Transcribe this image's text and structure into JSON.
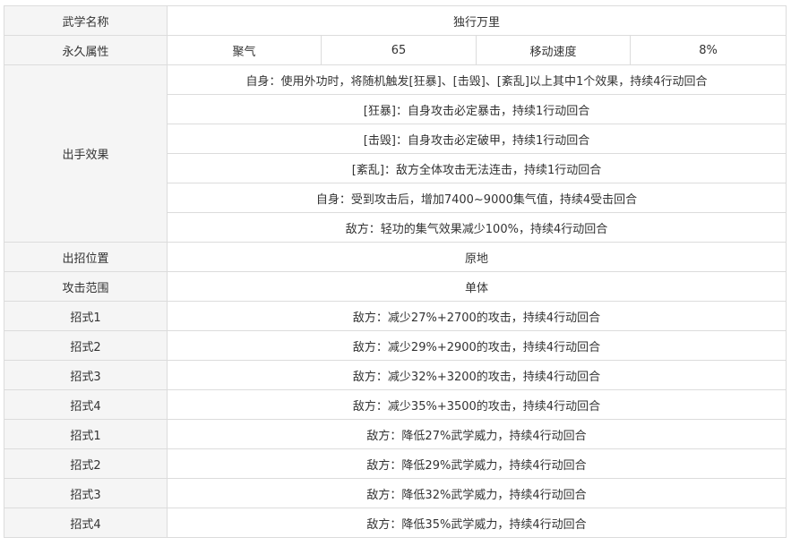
{
  "table": {
    "name_row": {
      "label": "武学名称",
      "value": "独行万里"
    },
    "attr_row": {
      "label": "永久属性",
      "cells": [
        "聚气",
        "65",
        "移动速度",
        "8%"
      ]
    },
    "effect_block": {
      "label": "出手效果",
      "lines": [
        "自身：使用外功时，将随机触发[狂暴]、[击毁]、[紊乱]以上其中1个效果，持续4行动回合",
        "[狂暴]：自身攻击必定暴击，持续1行动回合",
        "[击毁]：自身攻击必定破甲，持续1行动回合",
        "[紊乱]：敌方全体攻击无法连击，持续1行动回合",
        "自身：受到攻击后，增加7400~9000集气值，持续4受击回合",
        "敌方：轻功的集气效果减少100%，持续4行动回合"
      ]
    },
    "position_row": {
      "label": "出招位置",
      "value": "原地"
    },
    "range_row": {
      "label": "攻击范围",
      "value": "单体"
    },
    "moves": [
      {
        "label": "招式1",
        "value": "敌方：减少27%+2700的攻击，持续4行动回合"
      },
      {
        "label": "招式2",
        "value": "敌方：减少29%+2900的攻击，持续4行动回合"
      },
      {
        "label": "招式3",
        "value": "敌方：减少32%+3200的攻击，持续4行动回合"
      },
      {
        "label": "招式4",
        "value": "敌方：减少35%+3500的攻击，持续4行动回合"
      },
      {
        "label": "招式1",
        "value": "敌方：降低27%武学威力，持续4行动回合"
      },
      {
        "label": "招式2",
        "value": "敌方：降低29%武学威力，持续4行动回合"
      },
      {
        "label": "招式3",
        "value": "敌方：降低32%武学威力，持续4行动回合"
      },
      {
        "label": "招式4",
        "value": "敌方：降低35%武学威力，持续4行动回合"
      }
    ]
  }
}
